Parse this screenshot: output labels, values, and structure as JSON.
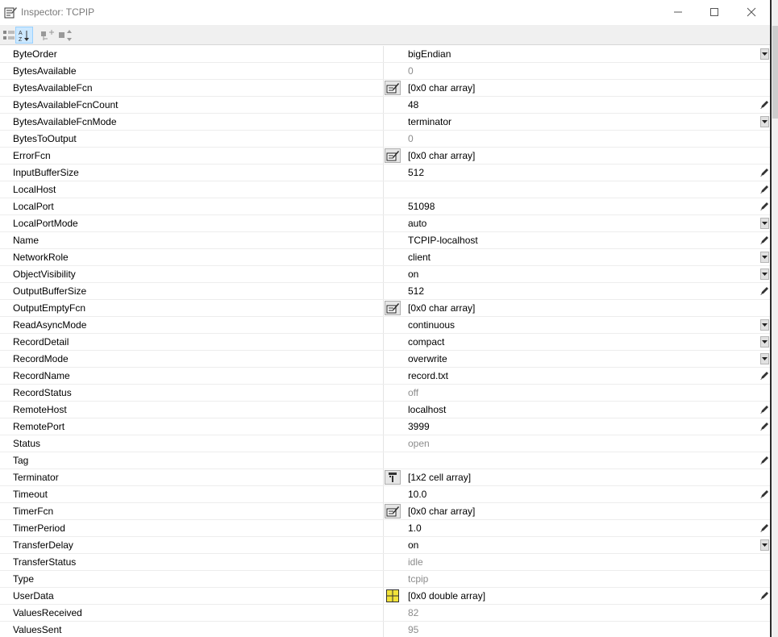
{
  "window": {
    "title": "Inspector:  TCPIP"
  },
  "toolbar": {
    "buttons": [
      {
        "icon": "categorized-icon",
        "active": false
      },
      {
        "icon": "sort-alphabetical-icon",
        "active": true
      },
      {
        "icon": "expand-all-icon",
        "active": false
      },
      {
        "icon": "collapse-all-icon",
        "active": false
      }
    ]
  },
  "properties": [
    {
      "name": "ByteOrder",
      "value": "bigEndian",
      "editor": "dropdown",
      "readonly": false
    },
    {
      "name": "BytesAvailable",
      "value": "0",
      "editor": "none",
      "readonly": true
    },
    {
      "name": "BytesAvailableFcn",
      "value": "[0x0  char array]",
      "editor": "none",
      "button": "callback-edit-icon",
      "readonly": false
    },
    {
      "name": "BytesAvailableFcnCount",
      "value": "48",
      "editor": "pencil",
      "readonly": false
    },
    {
      "name": "BytesAvailableFcnMode",
      "value": "terminator",
      "editor": "dropdown",
      "readonly": false
    },
    {
      "name": "BytesToOutput",
      "value": "0",
      "editor": "none",
      "readonly": true
    },
    {
      "name": "ErrorFcn",
      "value": "[0x0  char array]",
      "editor": "none",
      "button": "callback-edit-icon",
      "readonly": false
    },
    {
      "name": "InputBufferSize",
      "value": "512",
      "editor": "pencil",
      "readonly": false
    },
    {
      "name": "LocalHost",
      "value": "",
      "editor": "pencil",
      "readonly": false
    },
    {
      "name": "LocalPort",
      "value": "51098",
      "editor": "pencil",
      "readonly": false
    },
    {
      "name": "LocalPortMode",
      "value": "auto",
      "editor": "dropdown",
      "readonly": false
    },
    {
      "name": "Name",
      "value": "TCPIP-localhost",
      "editor": "pencil",
      "readonly": false
    },
    {
      "name": "NetworkRole",
      "value": "client",
      "editor": "dropdown",
      "readonly": false
    },
    {
      "name": "ObjectVisibility",
      "value": "on",
      "editor": "dropdown",
      "readonly": false
    },
    {
      "name": "OutputBufferSize",
      "value": "512",
      "editor": "pencil",
      "readonly": false
    },
    {
      "name": "OutputEmptyFcn",
      "value": "[0x0  char array]",
      "editor": "none",
      "button": "callback-edit-icon",
      "readonly": false
    },
    {
      "name": "ReadAsyncMode",
      "value": "continuous",
      "editor": "dropdown",
      "readonly": false
    },
    {
      "name": "RecordDetail",
      "value": "compact",
      "editor": "dropdown",
      "readonly": false
    },
    {
      "name": "RecordMode",
      "value": "overwrite",
      "editor": "dropdown",
      "readonly": false
    },
    {
      "name": "RecordName",
      "value": "record.txt",
      "editor": "pencil",
      "readonly": false
    },
    {
      "name": "RecordStatus",
      "value": "off",
      "editor": "none",
      "readonly": true
    },
    {
      "name": "RemoteHost",
      "value": "localhost",
      "editor": "pencil",
      "readonly": false
    },
    {
      "name": "RemotePort",
      "value": "3999",
      "editor": "pencil",
      "readonly": false
    },
    {
      "name": "Status",
      "value": "open",
      "editor": "none",
      "readonly": true
    },
    {
      "name": "Tag",
      "value": "",
      "editor": "pencil",
      "readonly": false
    },
    {
      "name": "Terminator",
      "value": "[1x2  cell array]",
      "editor": "none",
      "button": "cell-array-icon",
      "readonly": false
    },
    {
      "name": "Timeout",
      "value": "10.0",
      "editor": "pencil",
      "readonly": false
    },
    {
      "name": "TimerFcn",
      "value": "[0x0  char array]",
      "editor": "none",
      "button": "callback-edit-icon",
      "readonly": false
    },
    {
      "name": "TimerPeriod",
      "value": "1.0",
      "editor": "pencil",
      "readonly": false
    },
    {
      "name": "TransferDelay",
      "value": "on",
      "editor": "dropdown",
      "readonly": false
    },
    {
      "name": "TransferStatus",
      "value": "idle",
      "editor": "none",
      "readonly": true
    },
    {
      "name": "Type",
      "value": "tcpip",
      "editor": "none",
      "readonly": true
    },
    {
      "name": "UserData",
      "value": "[0x0  double array]",
      "editor": "pencil",
      "button": "array-editor-icon",
      "readonly": false
    },
    {
      "name": "ValuesReceived",
      "value": "82",
      "editor": "none",
      "readonly": true
    },
    {
      "name": "ValuesSent",
      "value": "95",
      "editor": "none",
      "readonly": true
    }
  ]
}
